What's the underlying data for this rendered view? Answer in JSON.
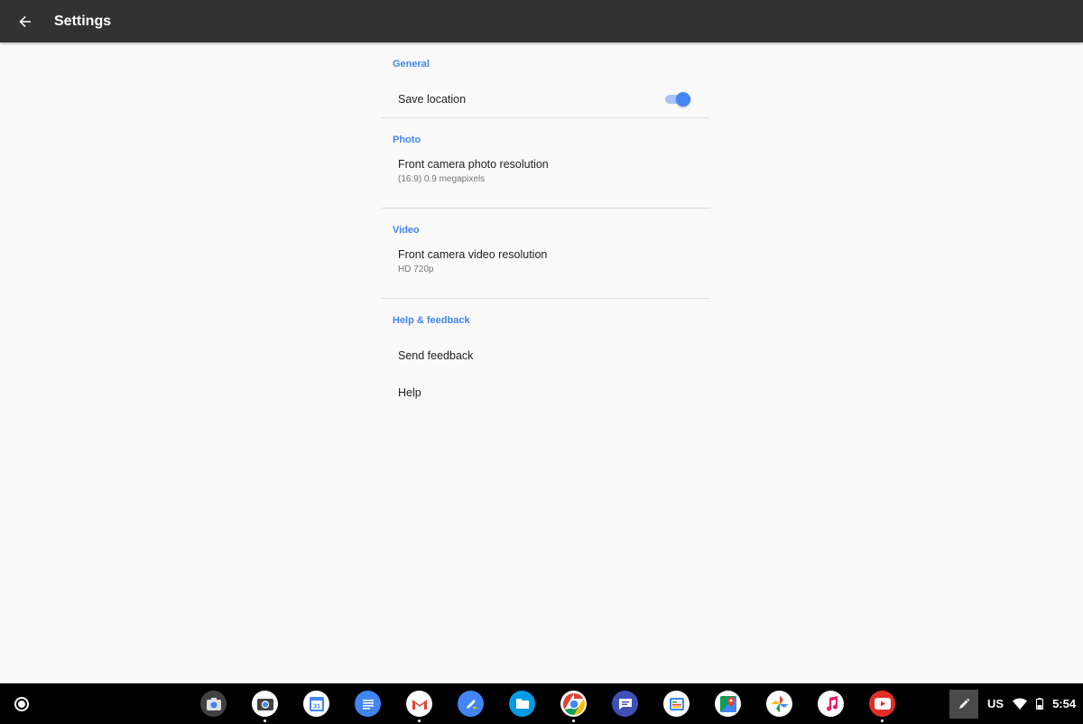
{
  "appbar": {
    "title": "Settings",
    "back_icon": "arrow-back-icon"
  },
  "sections": {
    "general": {
      "header": "General",
      "save_location": {
        "title": "Save location",
        "enabled": true
      }
    },
    "photo": {
      "header": "Photo",
      "front_photo": {
        "title": "Front camera photo resolution",
        "subtitle": "(16:9) 0.9 megapixels"
      }
    },
    "video": {
      "header": "Video",
      "front_video": {
        "title": "Front camera video resolution",
        "subtitle": "HD 720p"
      }
    },
    "help": {
      "header": "Help & feedback",
      "send_feedback": "Send feedback",
      "help": "Help"
    }
  },
  "shelf": {
    "launcher_icon": "launcher-circle-icon",
    "apps": [
      {
        "name": "camera-app",
        "color": "#424242",
        "running": false
      },
      {
        "name": "camera-active-app",
        "color": "#ffffff",
        "running": true
      },
      {
        "name": "calendar-app",
        "color": "#ffffff",
        "label": "31",
        "running": false
      },
      {
        "name": "docs-app",
        "color": "#4285f4",
        "running": false
      },
      {
        "name": "gmail-app",
        "color": "#ffffff",
        "running": true
      },
      {
        "name": "keep-pen-app",
        "color": "#4285f4",
        "running": false
      },
      {
        "name": "files-app",
        "color": "#039be5",
        "running": false
      },
      {
        "name": "chrome-app",
        "color": "#ffffff",
        "running": true
      },
      {
        "name": "messages-app",
        "color": "#3f51b5",
        "running": false
      },
      {
        "name": "news-app",
        "color": "#ffffff",
        "running": false
      },
      {
        "name": "maps-app",
        "color": "#ffffff",
        "running": false
      },
      {
        "name": "photos-app",
        "color": "#ffffff",
        "running": false
      },
      {
        "name": "music-app",
        "color": "#ffffff",
        "running": false
      },
      {
        "name": "youtube-app",
        "color": "#e52d27",
        "running": true
      }
    ],
    "pen_icon": "stylus-pen-icon",
    "ime": "US",
    "time": "5:54"
  }
}
